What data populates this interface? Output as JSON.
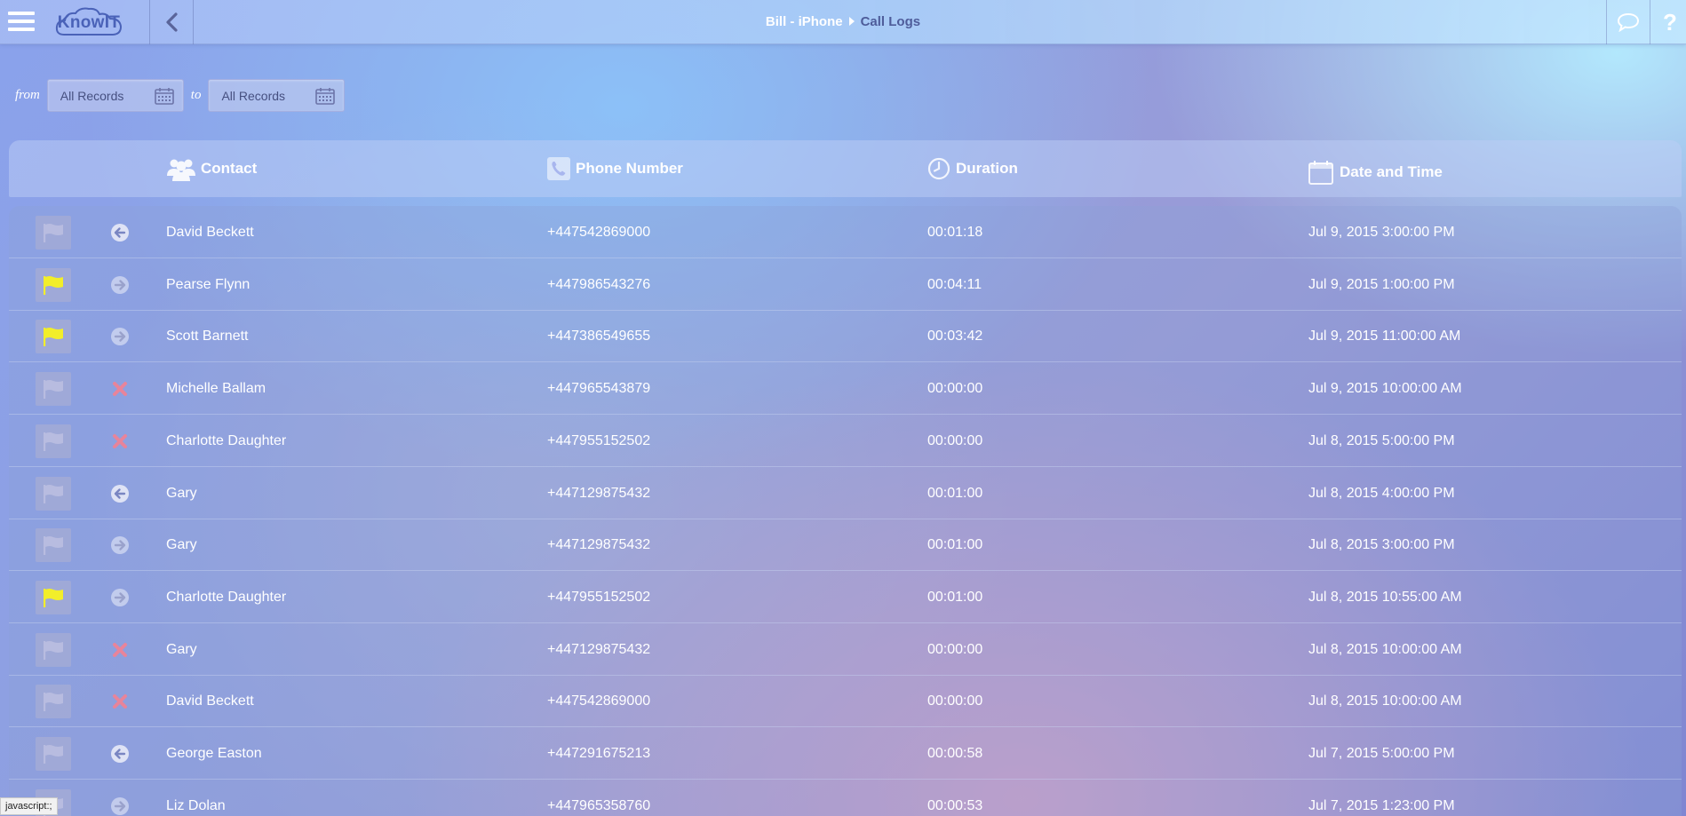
{
  "app": {
    "logo_text": "KnowIT"
  },
  "breadcrumb": {
    "device": "Bill - iPhone",
    "page": "Call Logs"
  },
  "filter": {
    "from_label": "from",
    "to_label": "to",
    "from_value": "All Records",
    "to_value": "All Records"
  },
  "table": {
    "headers": {
      "contact": "Contact",
      "phone": "Phone Number",
      "duration": "Duration",
      "date": "Date and Time"
    },
    "rows": [
      {
        "flagged": false,
        "direction": "incoming",
        "contact": "David Beckett",
        "phone": "+447542869000",
        "duration": "00:01:18",
        "date": "Jul 9, 2015 3:00:00 PM"
      },
      {
        "flagged": true,
        "direction": "outgoing",
        "contact": "Pearse Flynn",
        "phone": "+447986543276",
        "duration": "00:04:11",
        "date": "Jul 9, 2015 1:00:00 PM"
      },
      {
        "flagged": true,
        "direction": "outgoing",
        "contact": "Scott Barnett",
        "phone": "+447386549655",
        "duration": "00:03:42",
        "date": "Jul 9, 2015 11:00:00 AM"
      },
      {
        "flagged": false,
        "direction": "missed",
        "contact": "Michelle Ballam",
        "phone": "+447965543879",
        "duration": "00:00:00",
        "date": "Jul 9, 2015 10:00:00 AM"
      },
      {
        "flagged": false,
        "direction": "missed",
        "contact": "Charlotte Daughter",
        "phone": "+447955152502",
        "duration": "00:00:00",
        "date": "Jul 8, 2015 5:00:00 PM"
      },
      {
        "flagged": false,
        "direction": "incoming",
        "contact": "Gary",
        "phone": "+447129875432",
        "duration": "00:01:00",
        "date": "Jul 8, 2015 4:00:00 PM"
      },
      {
        "flagged": false,
        "direction": "outgoing",
        "contact": "Gary",
        "phone": "+447129875432",
        "duration": "00:01:00",
        "date": "Jul 8, 2015 3:00:00 PM"
      },
      {
        "flagged": true,
        "direction": "outgoing",
        "contact": "Charlotte Daughter",
        "phone": "+447955152502",
        "duration": "00:01:00",
        "date": "Jul 8, 2015 10:55:00 AM"
      },
      {
        "flagged": false,
        "direction": "missed",
        "contact": "Gary",
        "phone": "+447129875432",
        "duration": "00:00:00",
        "date": "Jul 8, 2015 10:00:00 AM"
      },
      {
        "flagged": false,
        "direction": "missed",
        "contact": "David Beckett",
        "phone": "+447542869000",
        "duration": "00:00:00",
        "date": "Jul 8, 2015 10:00:00 AM"
      },
      {
        "flagged": false,
        "direction": "incoming",
        "contact": "George Easton",
        "phone": "+447291675213",
        "duration": "00:00:58",
        "date": "Jul 7, 2015 5:00:00 PM"
      },
      {
        "flagged": false,
        "direction": "outgoing",
        "contact": "Liz Dolan",
        "phone": "+447965358760",
        "duration": "00:00:53",
        "date": "Jul 7, 2015 1:23:00 PM"
      }
    ]
  },
  "colors": {
    "flag_active": "#f2ee2a",
    "flag_inactive": "#b8bce0",
    "missed": "#e8849a",
    "direction_icon": "#dfe3f5"
  },
  "status_bar": {
    "text": "javascript:;"
  },
  "icons": {
    "menu": "hamburger-icon",
    "back": "chevron-left-icon",
    "chat": "chat-bubble-icon",
    "help": "question-mark-icon",
    "calendar": "calendar-icon",
    "contacts": "people-icon",
    "phone": "phone-icon",
    "clock": "clock-icon",
    "date": "calendar-icon"
  }
}
